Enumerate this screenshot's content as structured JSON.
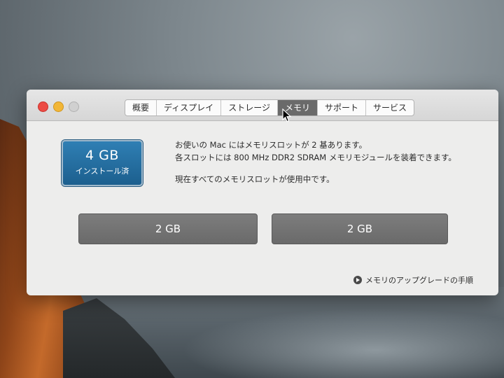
{
  "window": {
    "tabs": [
      {
        "label": "概要"
      },
      {
        "label": "ディスプレイ"
      },
      {
        "label": "ストレージ"
      },
      {
        "label": "メモリ"
      },
      {
        "label": "サポート"
      },
      {
        "label": "サービス"
      }
    ],
    "active_tab": "メモリ"
  },
  "memory": {
    "installed_amount": "4 GB",
    "installed_label": "インストール済",
    "info_line1": "お使いの Mac にはメモリスロットが 2 基あります。",
    "info_line2": "各スロットには 800 MHz DDR2 SDRAM メモリモジュールを装着できます。",
    "info_line3": "現在すべてのメモリスロットが使用中です。",
    "slots": [
      {
        "label": "2 GB"
      },
      {
        "label": "2 GB"
      }
    ],
    "upgrade_link": "メモリのアップグレードの手順"
  },
  "colors": {
    "active_tab_bg": "#6a6a6a",
    "badge_blue": "#2f7fb4",
    "slot_gray": "#747474"
  }
}
